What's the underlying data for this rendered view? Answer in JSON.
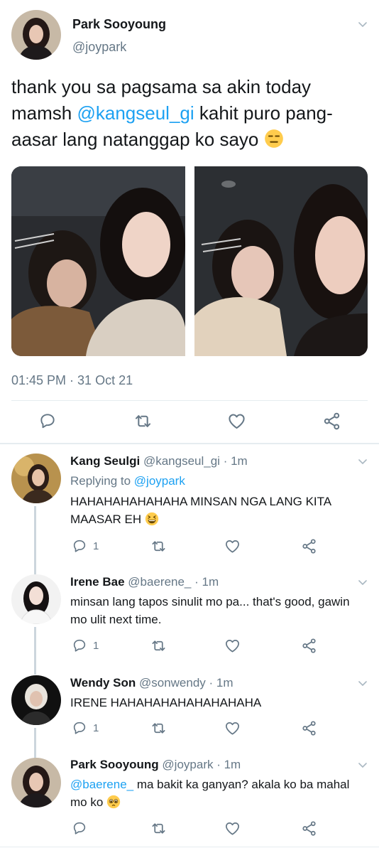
{
  "tweet": {
    "author_name": "Park Sooyoung",
    "author_handle": "@joypark",
    "text_part1": "thank you sa pagsama sa akin today mamsh ",
    "mention": "@kangseul_gi",
    "text_part2": " kahit puro pang-aasar lang natanggap ko sayo",
    "emoji": "expressionless-face",
    "timestamp": "01:45 PM · 31 Oct 21",
    "photos": [
      "selfie-photo-left",
      "selfie-photo-right"
    ]
  },
  "actions": {
    "icons": [
      "reply-icon",
      "retweet-icon",
      "like-icon",
      "share-icon"
    ]
  },
  "replies": [
    {
      "name": "Kang Seulgi",
      "handle": "@kangseul_gi",
      "time": "· 1m",
      "replying_to_label": "Replying to ",
      "replying_to_handle": "@joypark",
      "text": "HAHAHAHAHAHAHA MINSAN NGA LANG KITA MAASAR EH",
      "emoji": "grinning-squinting-face",
      "reply_count": "1"
    },
    {
      "name": "Irene Bae",
      "handle": "@baerene_",
      "time": "· 1m",
      "text": "minsan lang tapos sinulit mo pa... that's good, gawin mo ulit next time.",
      "reply_count": "1"
    },
    {
      "name": "Wendy Son",
      "handle": "@sonwendy",
      "time": "· 1m",
      "text": "IRENE HAHAHAHAHAHAHAHAHA",
      "reply_count": "1"
    },
    {
      "name": "Park Sooyoung",
      "handle": "@joypark",
      "time": "· 1m",
      "mention": "@baerene_",
      "text": " ma bakit ka ganyan? akala ko ba mahal mo ko",
      "emoji": "pleading-face",
      "reply_count": ""
    }
  ],
  "colors": {
    "accent": "#1da1f2",
    "icon_gray": "#657786",
    "divider": "#e6ecf0"
  }
}
